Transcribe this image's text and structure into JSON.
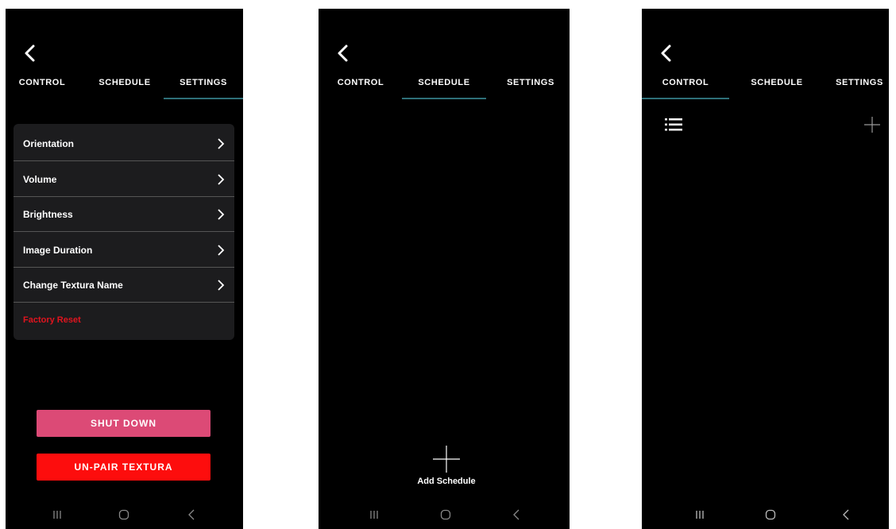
{
  "tabs": {
    "control": "CONTROL",
    "schedule": "SCHEDULE",
    "settings": "SETTINGS"
  },
  "screen_settings": {
    "active_tab": "settings",
    "rows": [
      {
        "label": "Orientation"
      },
      {
        "label": "Volume"
      },
      {
        "label": "Brightness"
      },
      {
        "label": "Image Duration"
      },
      {
        "label": "Change Textura Name"
      },
      {
        "label": "Factory Reset"
      }
    ],
    "buttons": {
      "shut_down": "SHUT DOWN",
      "unpair": "UN-PAIR TEXTURA"
    }
  },
  "screen_schedule": {
    "active_tab": "schedule",
    "add_schedule_label": "Add Schedule"
  },
  "screen_control": {
    "active_tab": "control"
  },
  "colors": {
    "background": "#000000",
    "tab_underline": "#2e6f78",
    "card": "#1c1c1e",
    "reset_text": "#e0141e",
    "shutdown_button": "#dc4a76",
    "unpair_button": "#fd0d0d"
  },
  "icons": {
    "back": "chevron-left-icon",
    "row_arrow": "chevron-right-icon",
    "add": "plus-icon",
    "list": "list-icon",
    "nav_recent": "recent-apps-icon",
    "nav_home": "home-icon",
    "nav_back": "nav-back-icon"
  }
}
